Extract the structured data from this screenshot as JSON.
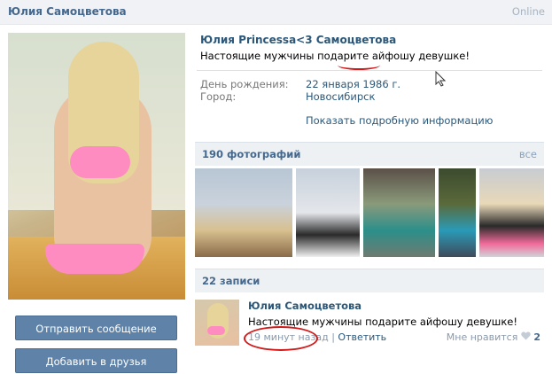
{
  "header": {
    "name": "Юлия Самоцветова",
    "status": "Online"
  },
  "profile": {
    "full_name": "Юлия Princessa<3 Самоцветова",
    "status_text": "Настоящие мужчины подарите айфошу девушке!",
    "birthday_label": "День рождения:",
    "birthday_value": "22 января 1986 г.",
    "city_label": "Город:",
    "city_value": "Новосибирск",
    "more_link": "Показать подробную информацию"
  },
  "buttons": {
    "send_message": "Отправить сообщение",
    "add_friend": "Добавить в друзья"
  },
  "photos": {
    "title": "190 фотографий",
    "all_link": "все"
  },
  "wall": {
    "title": "22 записи",
    "post": {
      "author": "Юлия Самоцветова",
      "text": "Настоящие мужчины подарите айфошу девушке!",
      "time": "19 минут назад",
      "separator": "|",
      "reply": "Ответить",
      "like_label": "Мне нравится",
      "like_count": "2"
    }
  },
  "colors": {
    "link": "#2b587a",
    "header_link": "#45688e",
    "button": "#5e82a8",
    "highlight": "#d21a1a"
  }
}
